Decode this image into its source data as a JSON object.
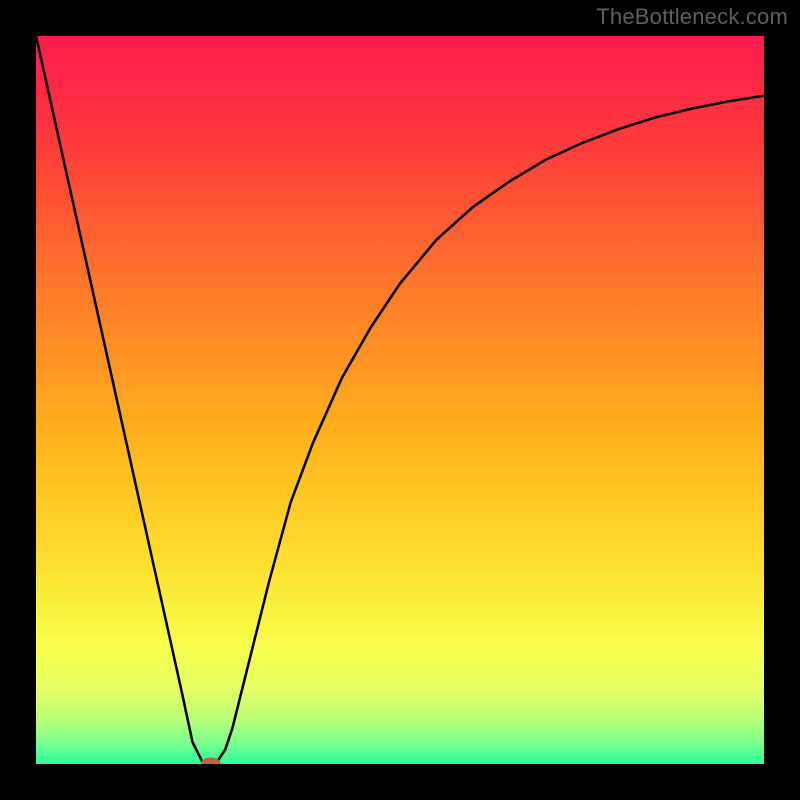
{
  "watermark": "TheBottleneck.com",
  "colors": {
    "page_bg": "#000000",
    "watermark": "#5f5f5f",
    "curve": "#000000",
    "marker_fill": "#c06048",
    "gradient_stops": [
      {
        "offset": 0.0,
        "color": "#ff1a4f"
      },
      {
        "offset": 0.15,
        "color": "#ff3b3b"
      },
      {
        "offset": 0.35,
        "color": "#ff7a2a"
      },
      {
        "offset": 0.55,
        "color": "#ffb21c"
      },
      {
        "offset": 0.72,
        "color": "#ffdf2e"
      },
      {
        "offset": 0.84,
        "color": "#f6ff4b"
      },
      {
        "offset": 0.9,
        "color": "#e4ff66"
      },
      {
        "offset": 0.94,
        "color": "#b6ff7a"
      },
      {
        "offset": 0.97,
        "color": "#7dff8e"
      },
      {
        "offset": 1.0,
        "color": "#2bff9d"
      }
    ]
  },
  "chart_data": {
    "type": "line",
    "title": "",
    "xlabel": "",
    "ylabel": "",
    "xlim": [
      0,
      100
    ],
    "ylim": [
      0,
      100
    ],
    "x": [
      0,
      4,
      8,
      12,
      16,
      20,
      21.5,
      23,
      24,
      25,
      26,
      27,
      28,
      30,
      32,
      35,
      38,
      42,
      46,
      50,
      55,
      60,
      65,
      70,
      75,
      80,
      85,
      90,
      95,
      100
    ],
    "y": [
      100,
      82,
      64,
      46,
      28,
      10,
      3,
      0,
      0,
      0.5,
      2,
      5,
      9,
      17,
      25,
      36,
      44,
      53,
      60,
      66,
      72,
      76.5,
      80,
      83,
      85.3,
      87.2,
      88.8,
      90,
      91,
      91.8
    ],
    "marker": {
      "x": 24,
      "y": 0,
      "rx": 1.4,
      "ry": 0.9
    }
  }
}
